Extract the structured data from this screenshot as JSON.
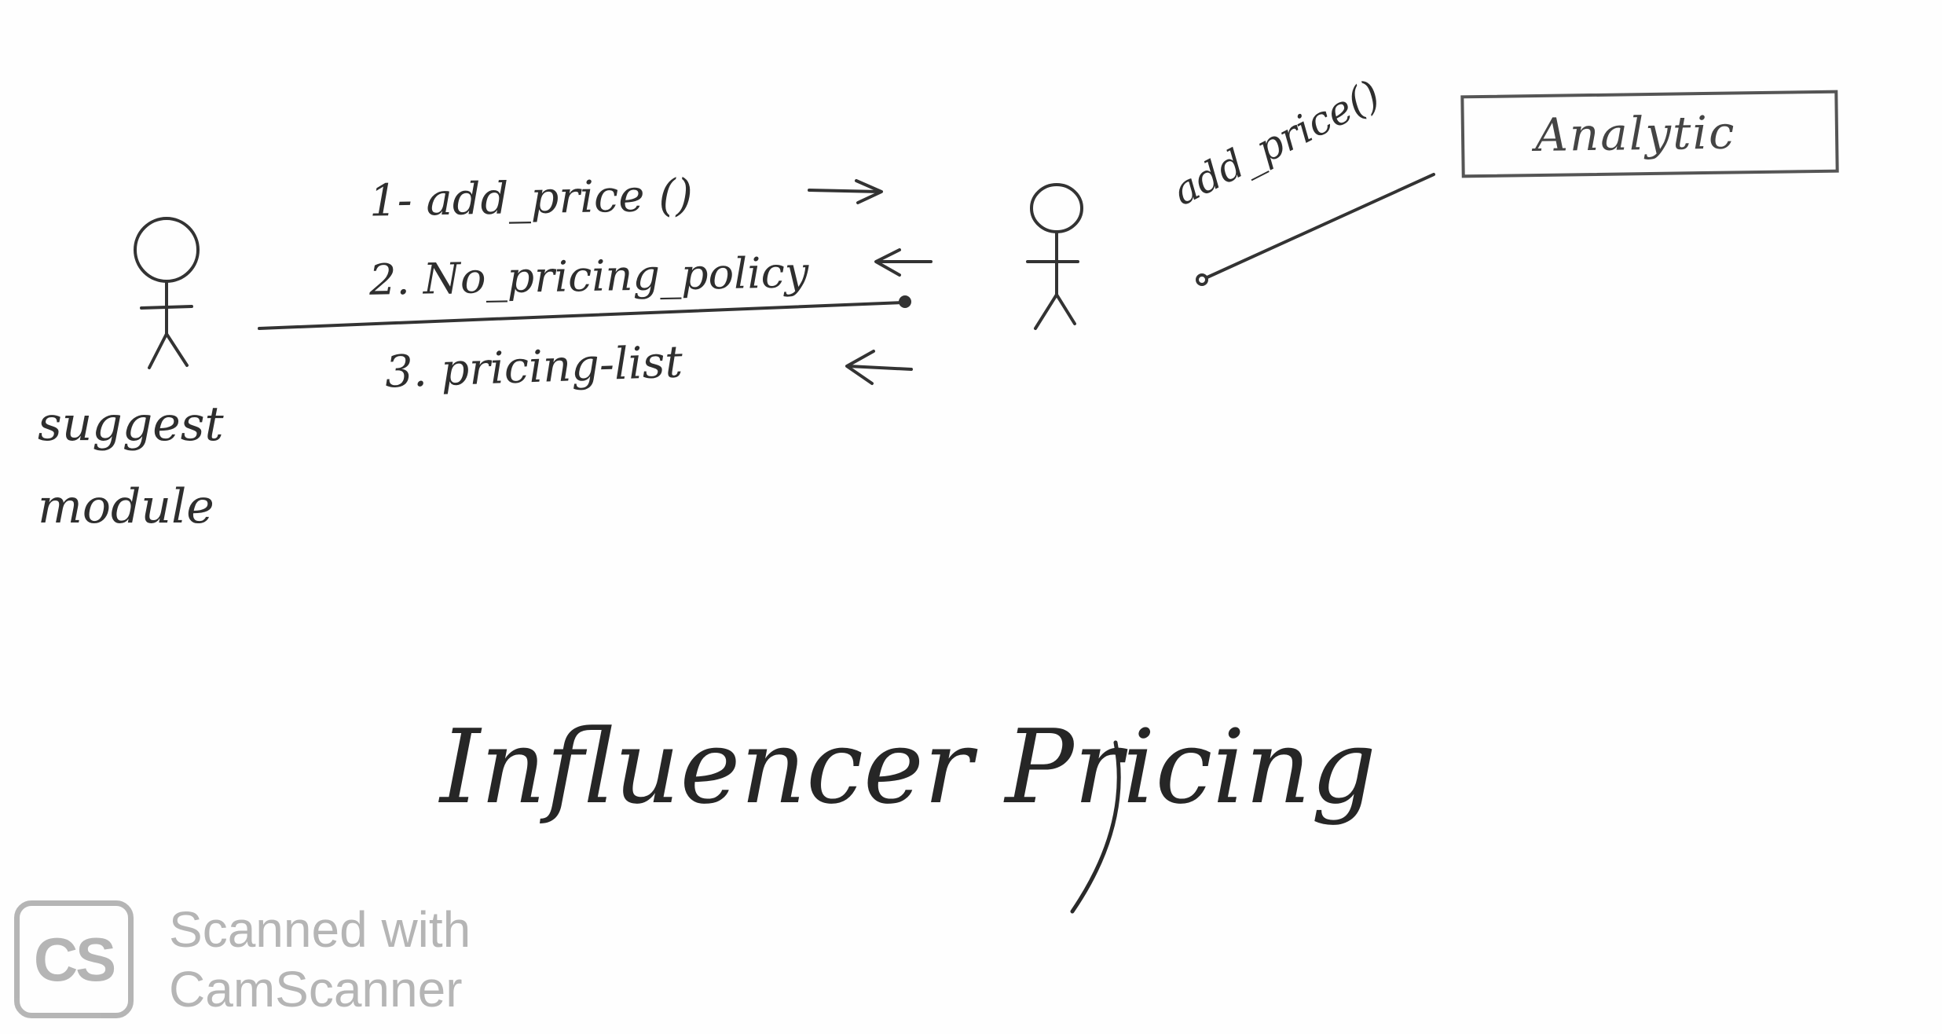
{
  "actors": {
    "left_label_line1": "suggest",
    "left_label_line2": "module"
  },
  "messages": [
    {
      "label": "1- add_price ()",
      "arrow": "→"
    },
    {
      "label": "2. No_pricing_policy",
      "arrow": "←"
    },
    {
      "label": "3. pricing-list",
      "arrow": "←"
    }
  ],
  "association": {
    "label": "add_price()"
  },
  "analytic": {
    "label": "Analytic"
  },
  "title": "Influencer Pricing",
  "watermark": {
    "logo": "CS",
    "line1": "Scanned with",
    "line2": "CamScanner"
  }
}
